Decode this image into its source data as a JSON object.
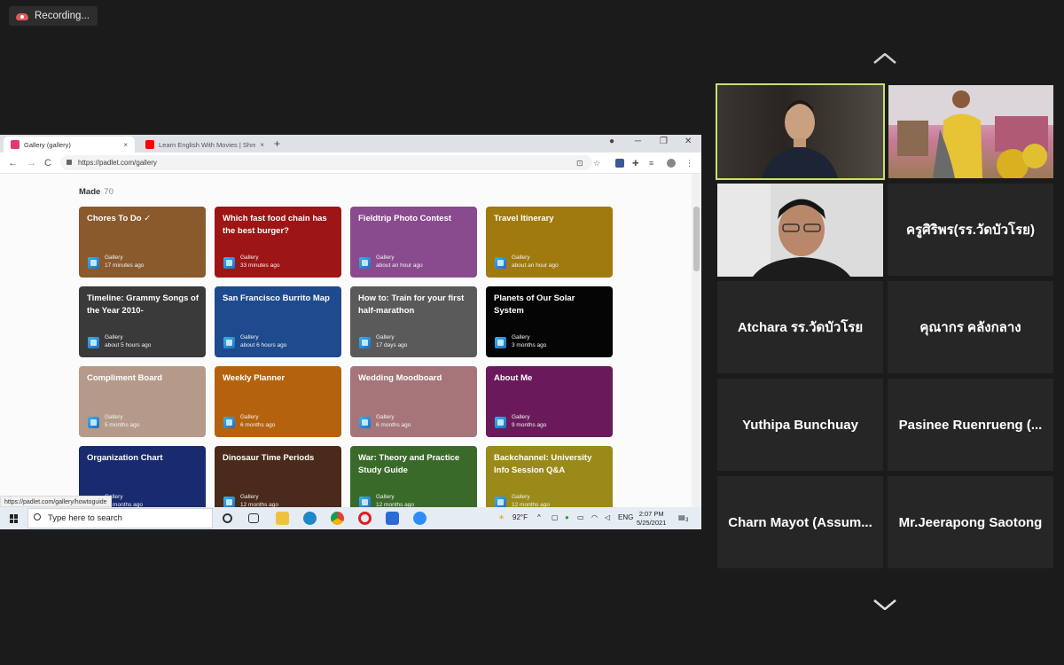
{
  "recording": {
    "label": "Recording..."
  },
  "browser": {
    "tabs": [
      {
        "label": "Gallery (gallery)",
        "close": "×",
        "favicon_color": "#e23a6f"
      },
      {
        "label": "Learn English With Movies | Shre",
        "close": "×",
        "favicon_color": "#ff0000"
      }
    ],
    "new_tab": "+",
    "window_controls": [
      "●",
      "─",
      "❐",
      "✕"
    ],
    "nav": {
      "back": "←",
      "forward": "→",
      "reload": "C"
    },
    "url": "https://padlet.com/gallery",
    "status_url": "https://padlet.com/gallery/howtoguide"
  },
  "page": {
    "section_title": "Made",
    "section_count": "70",
    "cards": [
      {
        "title": "Chores To Do ✓",
        "meta": "Gallery",
        "time": "17 minutes ago",
        "bg": "#8a5a2c"
      },
      {
        "title": "Which fast food chain has the best burger?",
        "meta": "Gallery",
        "time": "33 minutes ago",
        "bg": "#9e1515"
      },
      {
        "title": "Fieldtrip Photo Contest",
        "meta": "Gallery",
        "time": "about an hour ago",
        "bg": "#8a4a8e"
      },
      {
        "title": "Travel Itinerary",
        "meta": "Gallery",
        "time": "about an hour ago",
        "bg": "#a07a0e"
      },
      {
        "title": "Timeline: Grammy Songs of the Year 2010-",
        "meta": "Gallery",
        "time": "about 5 hours ago",
        "bg": "#3a3a3a"
      },
      {
        "title": "San Francisco Burrito Map",
        "meta": "Gallery",
        "time": "about 6 hours ago",
        "bg": "#1e4a8e"
      },
      {
        "title": "How to: Train for your first half-marathon",
        "meta": "Gallery",
        "time": "17 days ago",
        "bg": "#5a5a5a"
      },
      {
        "title": "Planets of Our Solar System",
        "meta": "Gallery",
        "time": "3 months ago",
        "bg": "#050505"
      },
      {
        "title": "Compliment Board",
        "meta": "Gallery",
        "time": "5 months ago",
        "bg": "#b59a8a"
      },
      {
        "title": "Weekly Planner",
        "meta": "Gallery",
        "time": "6 months ago",
        "bg": "#b5620f"
      },
      {
        "title": "Wedding Moodboard",
        "meta": "Gallery",
        "time": "6 months ago",
        "bg": "#a5757a"
      },
      {
        "title": "About Me",
        "meta": "Gallery",
        "time": "9 months ago",
        "bg": "#6a1a5a"
      },
      {
        "title": "Organization Chart",
        "meta": "Gallery",
        "time": "12 months ago",
        "bg": "#1a2a6e"
      },
      {
        "title": "Dinosaur Time Periods",
        "meta": "Gallery",
        "time": "12 months ago",
        "bg": "#4a2a1a"
      },
      {
        "title": "War: Theory and Practice Study Guide",
        "meta": "Gallery",
        "time": "12 months ago",
        "bg": "#3a6a2a"
      },
      {
        "title": "Backchannel: University Info Session Q&A",
        "meta": "Gallery",
        "time": "12 months ago",
        "bg": "#9a8a1a"
      }
    ]
  },
  "taskbar": {
    "search_placeholder": "Type here to search",
    "temperature": "92°F",
    "language": "ENG",
    "time": "2:07 PM",
    "date": "5/25/2021",
    "notifications": "3"
  },
  "participants": [
    {
      "name": "ครูศิริพร(รร.วัดบัวโรย)"
    },
    {
      "name": "Atchara รร.วัดบัวโรย"
    },
    {
      "name": "คุณากร  คลังกลาง"
    },
    {
      "name": "Yuthipa Bunchuay"
    },
    {
      "name": "Pasinee Ruenrueng  (..."
    },
    {
      "name": "Charn  Mayot (Assum..."
    },
    {
      "name": "Mr.Jeerapong  Saotong"
    }
  ]
}
